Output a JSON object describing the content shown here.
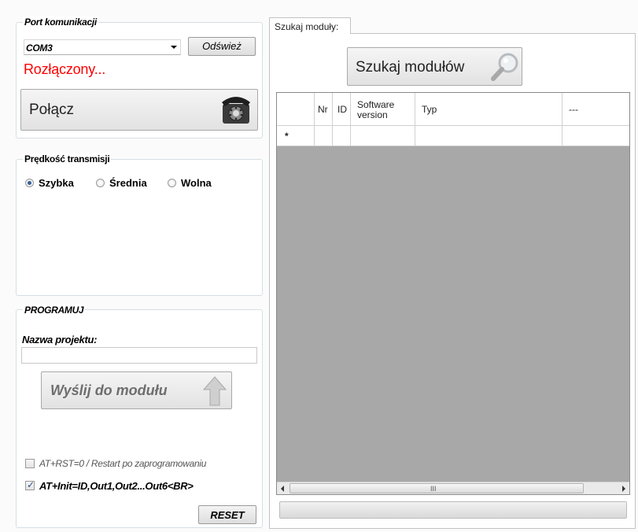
{
  "port_group": {
    "title": "Port komunikacji",
    "com_selected": "COM3",
    "refresh_label": "Odśwież",
    "status": "Rozłączony...",
    "connect_label": "Połącz"
  },
  "speed_group": {
    "title": "Prędkość transmisji",
    "options": [
      "Szybka",
      "Średnia",
      "Wolna"
    ],
    "selected": "Szybka"
  },
  "program_group": {
    "title": "PROGRAMUJ",
    "project_name_label": "Nazwa projektu:",
    "project_name_value": "",
    "send_label": "Wyślij do modułu",
    "restart_label": "AT+RST=0 / Restart po zaprogramowaniu",
    "restart_checked": false,
    "init_label": "AT+Init=ID,Out1,Out2...Out6<BR>",
    "init_checked": true,
    "reset_label": "RESET"
  },
  "search_tab": {
    "tab_label": "Szukaj moduły:",
    "search_label": "Szukaj modułów",
    "columns": [
      "Nr",
      "ID",
      "Software version",
      "Typ",
      "---"
    ],
    "new_row_marker": "*",
    "scroll_grip": "III"
  },
  "colors": {
    "status_red": "#ff0000",
    "grid_background": "#a8a8a8"
  }
}
